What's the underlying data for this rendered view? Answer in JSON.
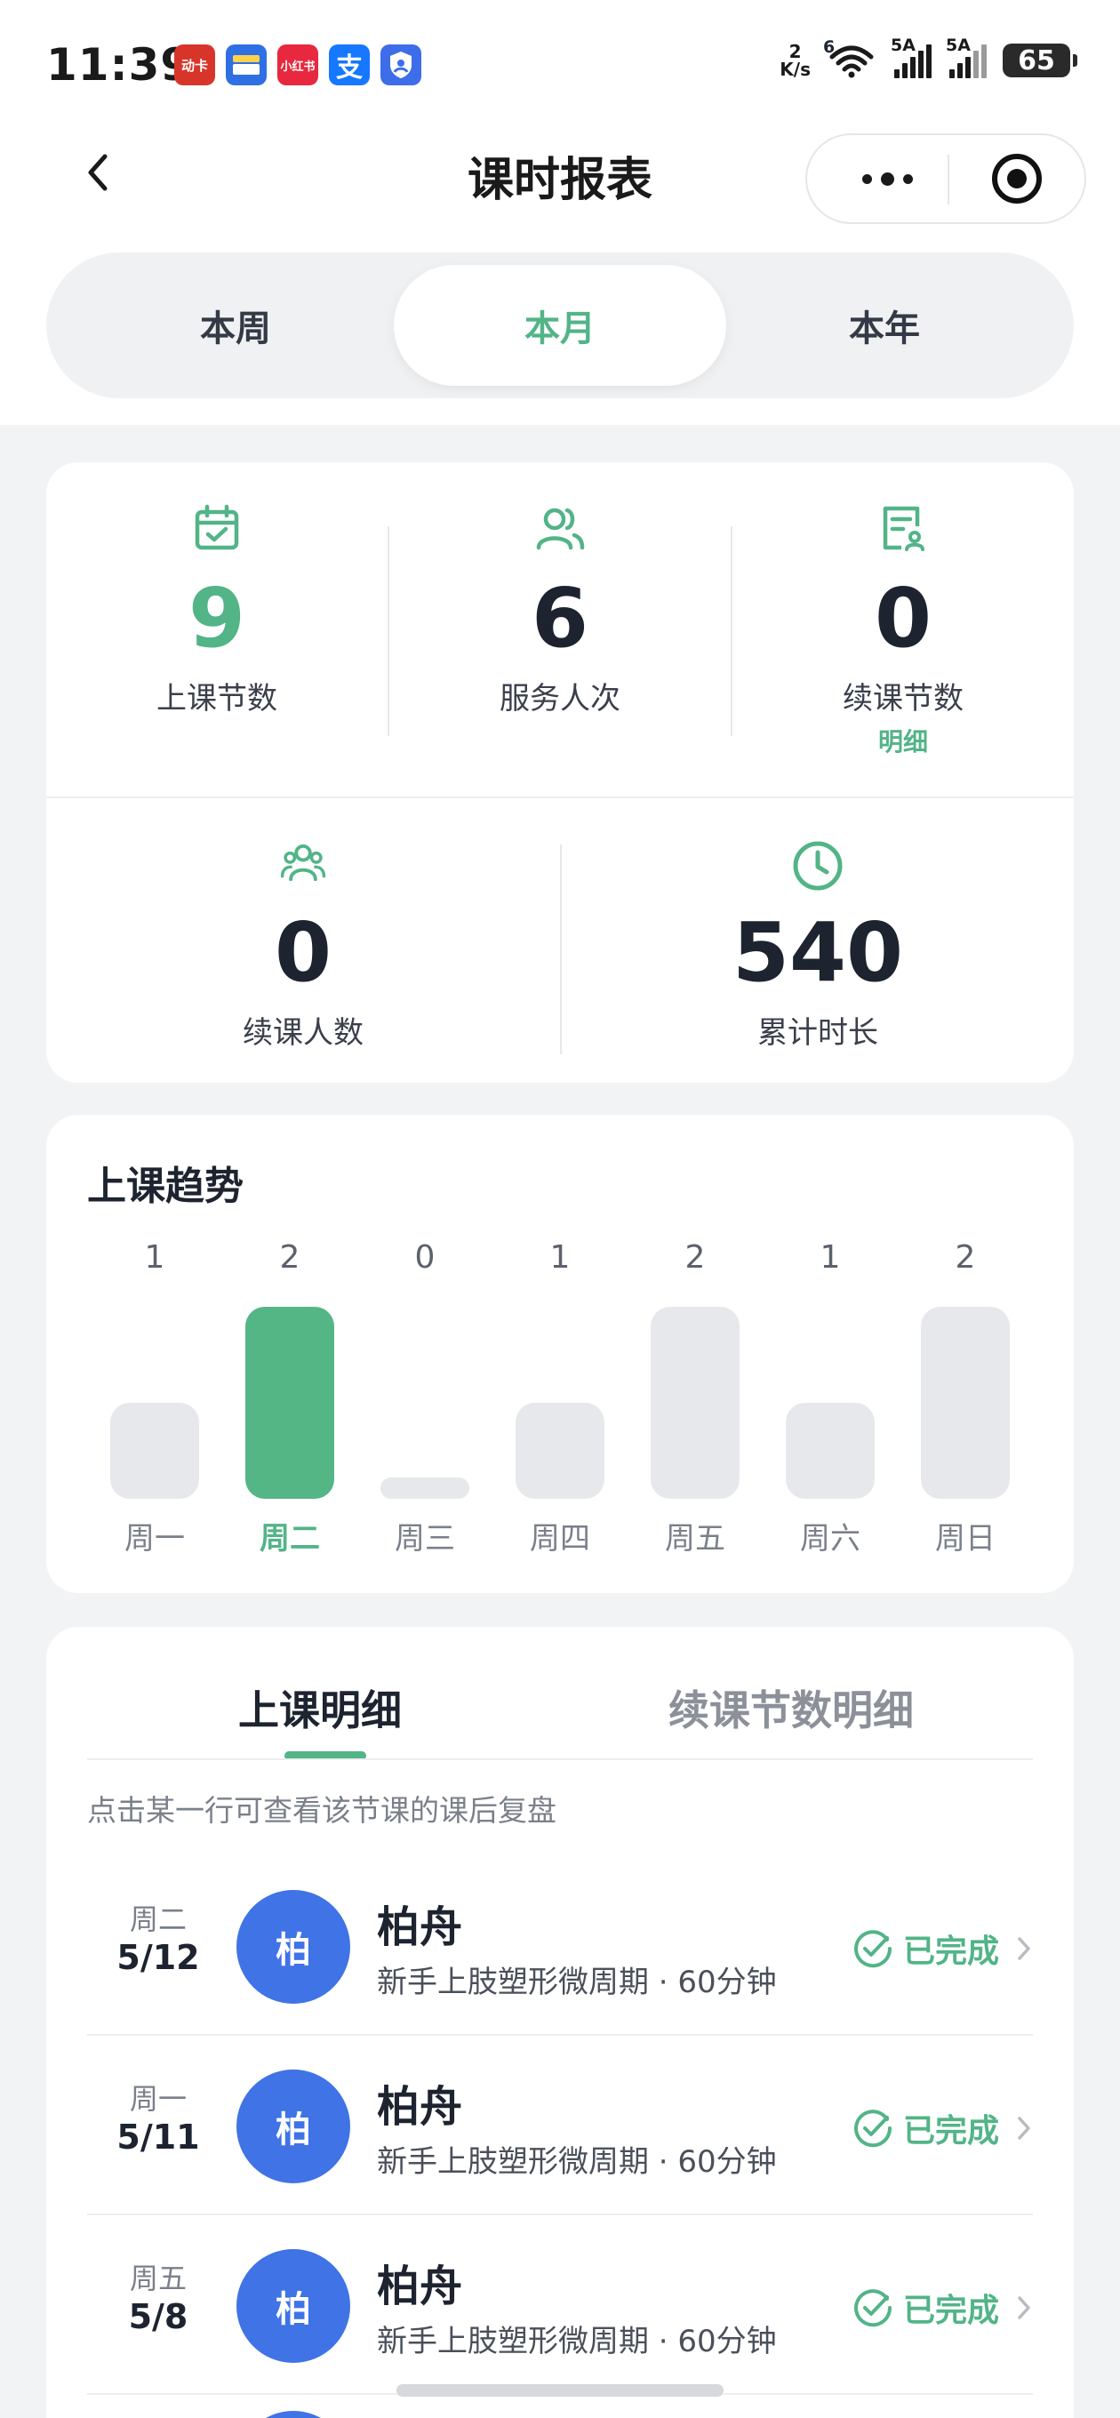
{
  "status_bar": {
    "time": "11:39",
    "apps": [
      {
        "name": "app-icon-1",
        "text": "动卡",
        "color": "#d8352a"
      },
      {
        "name": "app-icon-2",
        "text": "",
        "color": "#2f6fe4"
      },
      {
        "name": "app-icon-3",
        "text": "小红书",
        "color": "#e8283e"
      },
      {
        "name": "app-icon-4",
        "text": "支",
        "color": "#1677ff"
      },
      {
        "name": "app-icon-5",
        "text": "",
        "color": "#3d6de8"
      }
    ],
    "net_speed_value": "2",
    "net_speed_unit": "K/s",
    "wifi_label": "6",
    "sim1_label": "5A",
    "sim2_label": "5A",
    "battery": "65"
  },
  "nav": {
    "title": "课时报表"
  },
  "period_tabs": [
    {
      "label": "本周",
      "active": false
    },
    {
      "label": "本月",
      "active": true
    },
    {
      "label": "本年",
      "active": false
    }
  ],
  "stats": {
    "lessons": {
      "value": "9",
      "label": "上课节数"
    },
    "served": {
      "value": "6",
      "label": "服务人次"
    },
    "renewal_lessons": {
      "value": "0",
      "label": "续课节数",
      "link": "明细"
    },
    "renewal_people": {
      "value": "0",
      "label": "续课人数"
    },
    "total_duration": {
      "value": "540",
      "label": "累计时长"
    }
  },
  "trend": {
    "title": "上课趋势"
  },
  "chart_data": {
    "type": "bar",
    "categories": [
      "周一",
      "周二",
      "周三",
      "周四",
      "周五",
      "周六",
      "周日"
    ],
    "values": [
      1,
      2,
      0,
      1,
      2,
      1,
      2
    ],
    "highlight_index": 1,
    "colors": {
      "highlight": "#55b685",
      "bar": "#e6e8ec",
      "label": "#5c626c",
      "highlight_label": "#52b487"
    }
  },
  "detail": {
    "tabs": [
      {
        "label": "上课明细",
        "active": true
      },
      {
        "label": "续课节数明细",
        "active": false
      }
    ],
    "hint": "点击某一行可查看该节课的课后复盘",
    "rows": [
      {
        "weekday": "周二",
        "date": "5/12",
        "avatar": "柏",
        "name": "柏舟",
        "course": "新手上肢塑形微周期 · 60分钟",
        "status": "已完成"
      },
      {
        "weekday": "周一",
        "date": "5/11",
        "avatar": "柏",
        "name": "柏舟",
        "course": "新手上肢塑形微周期 · 60分钟",
        "status": "已完成"
      },
      {
        "weekday": "周五",
        "date": "5/8",
        "avatar": "柏",
        "name": "柏舟",
        "course": "新手上肢塑形微周期 · 60分钟",
        "status": "已完成"
      }
    ]
  },
  "colors": {
    "accent": "#52b487",
    "avatar": "#3f73e6"
  }
}
